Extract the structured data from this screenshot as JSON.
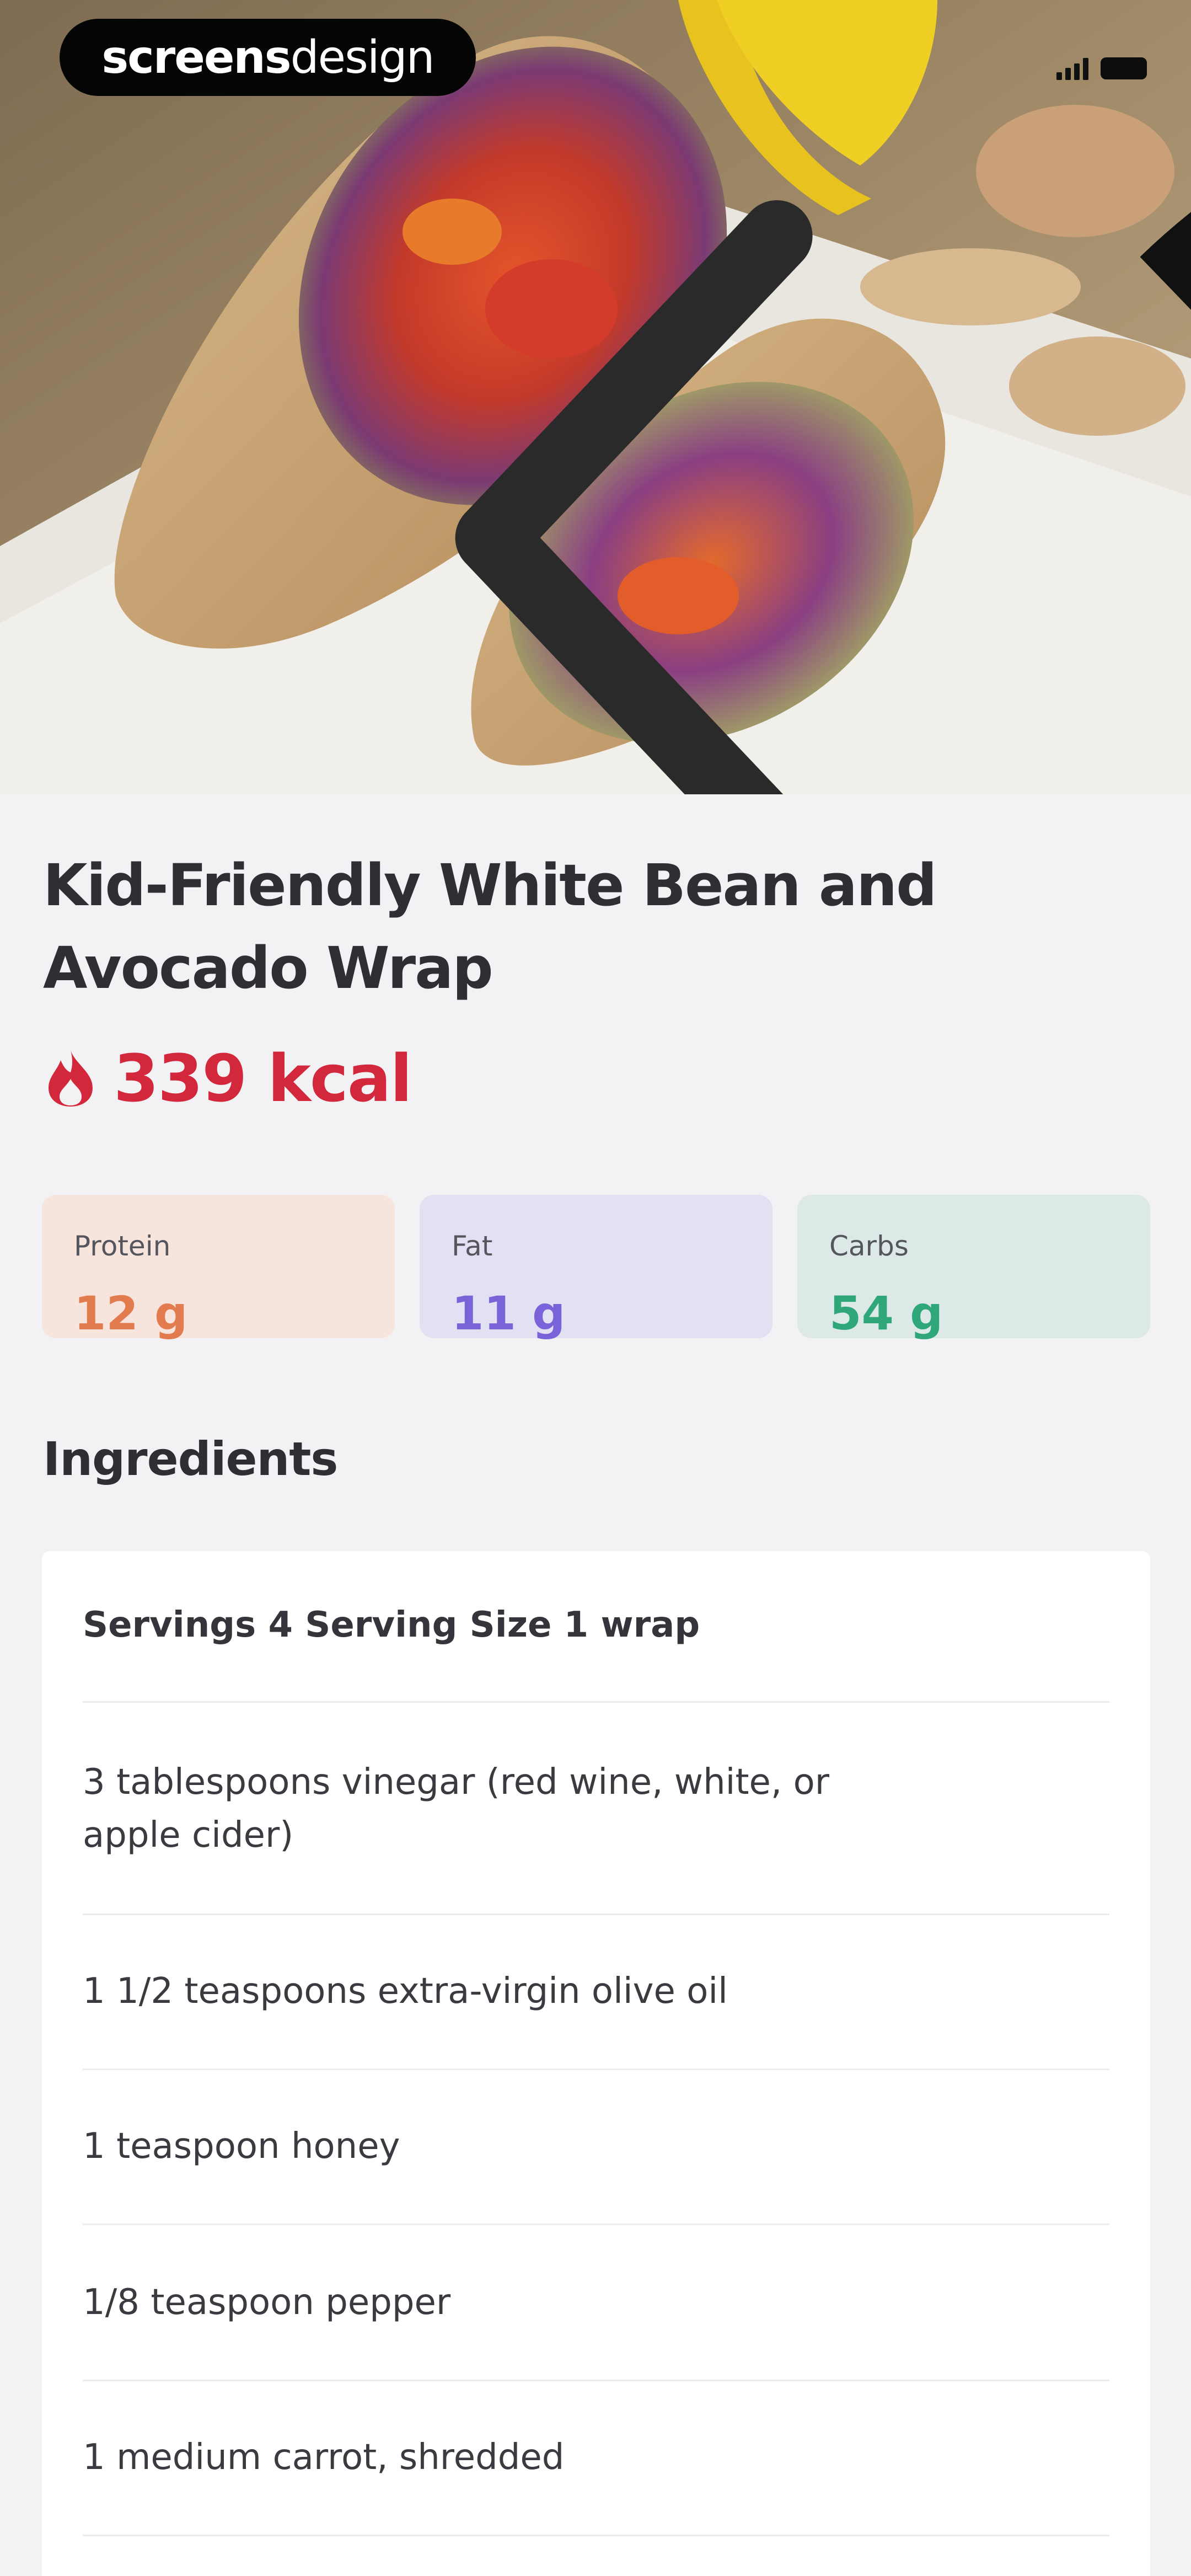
{
  "watermark": {
    "bold": "screens",
    "light": "design"
  },
  "recipe": {
    "title": "Kid-Friendly White Bean and Avocado Wrap",
    "calories": "339 kcal"
  },
  "macros": [
    {
      "label": "Protein",
      "value": "12 g",
      "bg": "#f7e4dc",
      "color": "#e27b4e"
    },
    {
      "label": "Fat",
      "value": "11 g",
      "bg": "#e2e0f3",
      "color": "#7a62d8"
    },
    {
      "label": "Carbs",
      "value": "54 g",
      "bg": "#dde9e6",
      "color": "#2fa77b"
    }
  ],
  "ingredients": {
    "title": "Ingredients",
    "servings": "Servings 4 Serving Size 1 wrap",
    "items": [
      "3 tablespoons vinegar (red wine, white, or apple cider)",
      "1 1/2 teaspoons extra-virgin olive oil",
      "1 teaspoon honey",
      "1/8 teaspoon pepper",
      "1 medium carrot, shredded"
    ]
  },
  "icons": {
    "back": "chevron-left-icon",
    "calories": "flame-icon",
    "signal": "signal-icon",
    "wifi": "wifi-icon",
    "battery": "battery-icon"
  },
  "colors": {
    "accent_red": "#d3283c",
    "background": "#f2f2f5",
    "card": "#ffffff",
    "title": "#2e2e33"
  }
}
